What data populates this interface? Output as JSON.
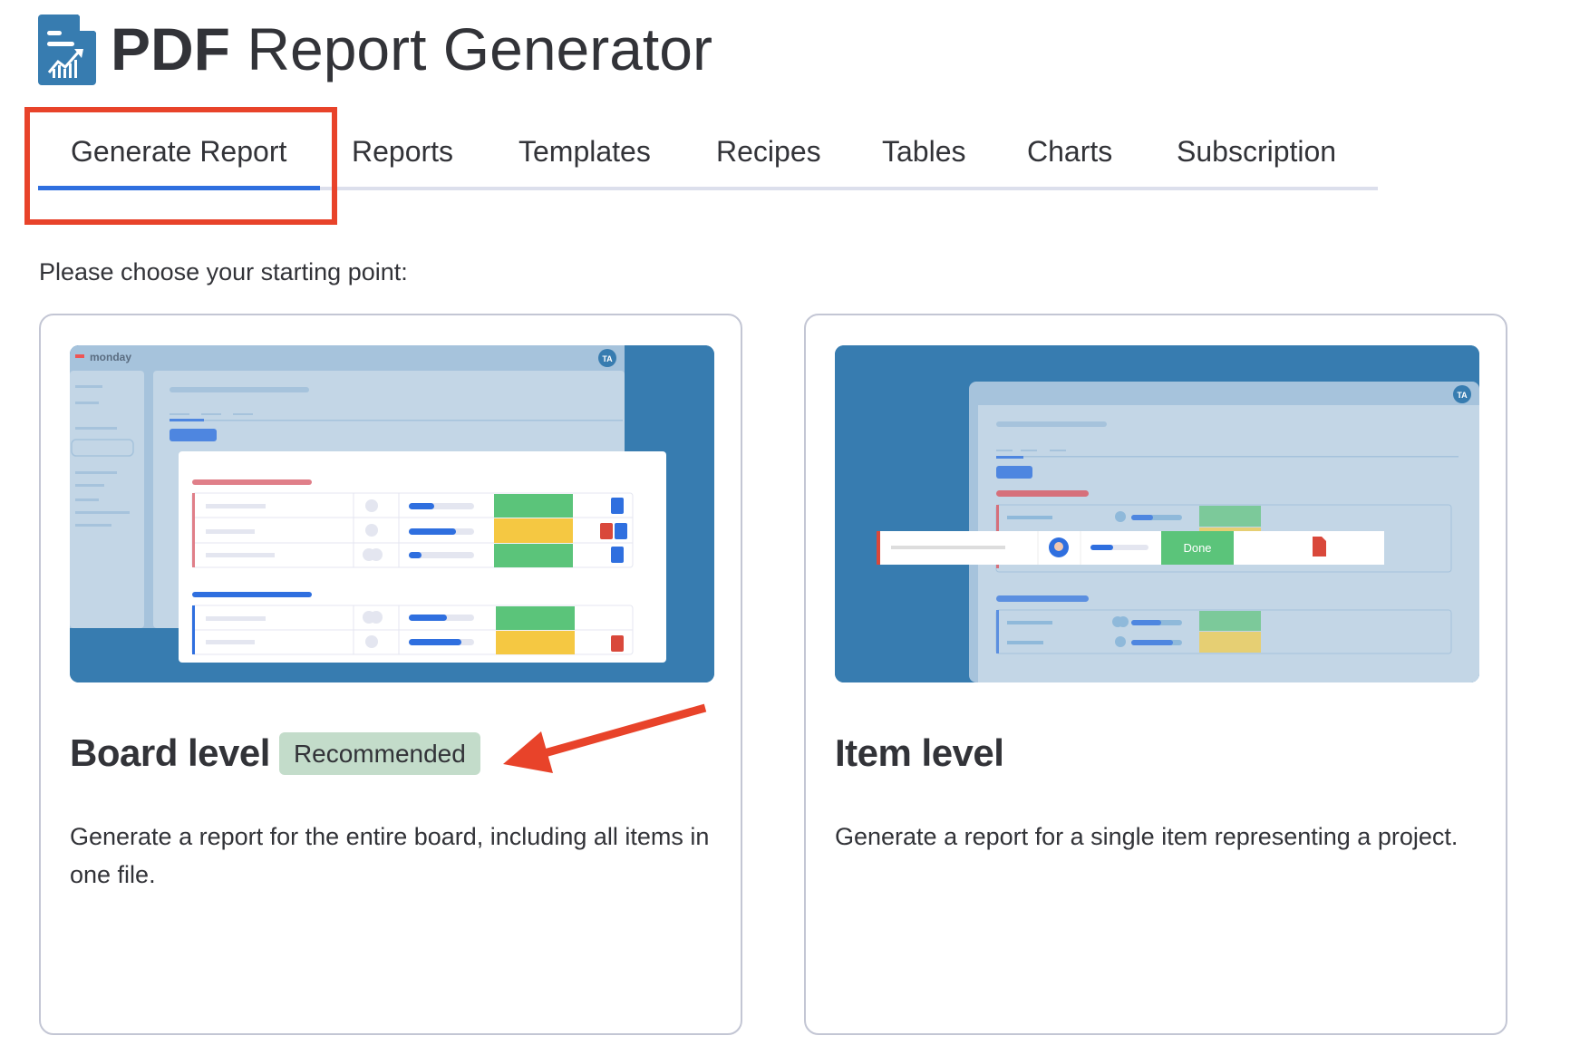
{
  "header": {
    "title_bold": "PDF",
    "title_rest": "Report Generator",
    "logo_icon": "document-chart-icon"
  },
  "tabs": [
    {
      "label": "Generate Report",
      "active": true
    },
    {
      "label": "Reports",
      "active": false
    },
    {
      "label": "Templates",
      "active": false
    },
    {
      "label": "Recipes",
      "active": false
    },
    {
      "label": "Tables",
      "active": false
    },
    {
      "label": "Charts",
      "active": false
    },
    {
      "label": "Subscription",
      "active": false
    }
  ],
  "prompt": "Please choose your starting point:",
  "cards": [
    {
      "title": "Board level",
      "badge": "Recommended",
      "description": "Generate a report for the entire board, including all items in one file.",
      "preview": {
        "brand": "monday",
        "avatar": "TA"
      }
    },
    {
      "title": "Item level",
      "description": "Generate a report for a single item representing a project.",
      "preview": {
        "avatar": "TA",
        "status": "Done",
        "file_label": "PDF"
      }
    }
  ],
  "colors": {
    "accent_blue": "#2f6fdf",
    "annotation_red": "#e8432a",
    "badge_green": "#c3dcca",
    "preview_blue": "#377cb0",
    "status_green": "#5bc47a",
    "status_yellow": "#f5c842"
  }
}
